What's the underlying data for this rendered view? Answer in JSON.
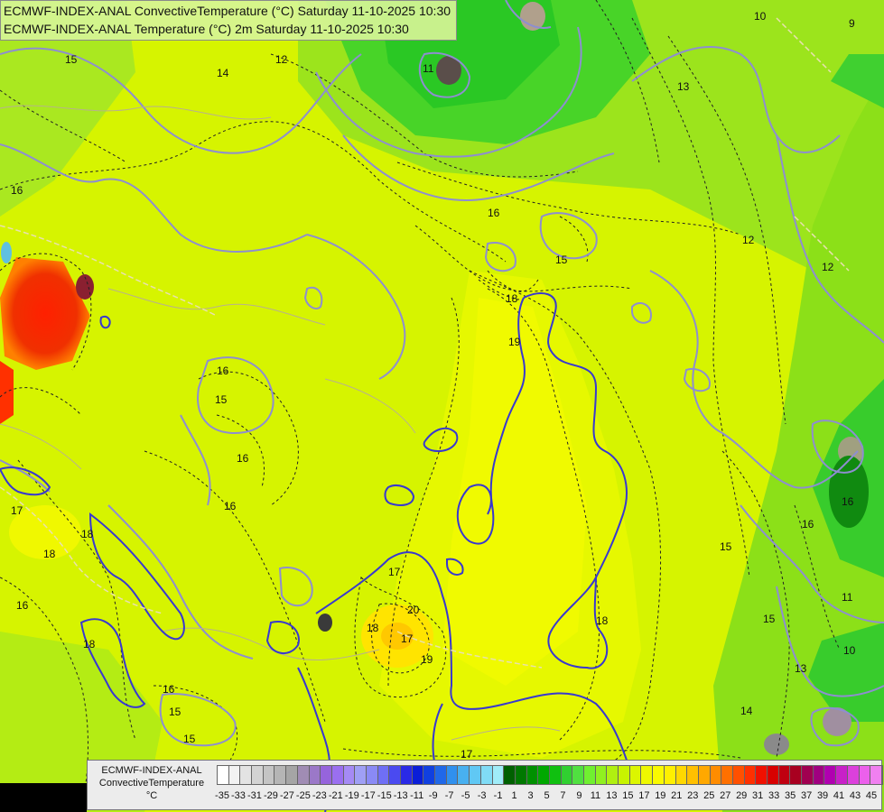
{
  "header": {
    "line1": "ECMWF-INDEX-ANAL ConvectiveTemperature (°C) Saturday 11-10-2025 10:30",
    "line2": "ECMWF-INDEX-ANAL Temperature (°C) 2m Saturday 11-10-2025 10:30"
  },
  "legend": {
    "line1": "ECMWF-INDEX-ANAL",
    "line2": "ConvectiveTemperature",
    "unit": "°C",
    "tick_labels": [
      "-35",
      "-33",
      "-31",
      "-29",
      "-27",
      "-25",
      "-23",
      "-21",
      "-19",
      "-17",
      "-15",
      "-13",
      "-11",
      "-9",
      "-7",
      "-5",
      "-3",
      "-1",
      "1",
      "3",
      "5",
      "7",
      "9",
      "11",
      "13",
      "15",
      "17",
      "19",
      "21",
      "23",
      "25",
      "27",
      "29",
      "31",
      "33",
      "35",
      "37",
      "39",
      "41",
      "43",
      "45"
    ],
    "colors": [
      "#ffffff",
      "#f2f2f2",
      "#e3e3e3",
      "#d3d3d3",
      "#c4c4c4",
      "#b5b5b5",
      "#a5a5a5",
      "#a08cb4",
      "#9b78c8",
      "#9664dc",
      "#9a6ff0",
      "#a58af5",
      "#9f9ff5",
      "#8a8af5",
      "#6f6ff5",
      "#4a4af0",
      "#2a2ae6",
      "#0a1ed8",
      "#1040e0",
      "#2068e8",
      "#3090ee",
      "#48b0f0",
      "#60c8f4",
      "#80dcf6",
      "#a0ecf8",
      "#006000",
      "#007800",
      "#009000",
      "#00a800",
      "#10c010",
      "#30d030",
      "#50e040",
      "#70f030",
      "#90f020",
      "#b0f010",
      "#c8f400",
      "#dcf600",
      "#eef800",
      "#fafa00",
      "#fff000",
      "#ffd800",
      "#ffc000",
      "#ffa800",
      "#ff8c00",
      "#ff7000",
      "#ff5000",
      "#ff3000",
      "#f01000",
      "#d80000",
      "#c00010",
      "#a80020",
      "#a00050",
      "#a00080",
      "#b000b0",
      "#c820c8",
      "#dc40dc",
      "#ec60ec",
      "#f080f0"
    ]
  },
  "contour_labels": [
    {
      "text": "15"
    },
    {
      "text": "12"
    },
    {
      "text": "14"
    },
    {
      "text": "11"
    },
    {
      "text": "10"
    },
    {
      "text": "9"
    },
    {
      "text": "13"
    },
    {
      "text": "16"
    },
    {
      "text": "16"
    },
    {
      "text": "15"
    },
    {
      "text": "18"
    },
    {
      "text": "19"
    },
    {
      "text": "12"
    },
    {
      "text": "12"
    },
    {
      "text": "16"
    },
    {
      "text": "15"
    },
    {
      "text": "16"
    },
    {
      "text": "17"
    },
    {
      "text": "16"
    },
    {
      "text": "18"
    },
    {
      "text": "18"
    },
    {
      "text": "16"
    },
    {
      "text": "17"
    },
    {
      "text": "18"
    },
    {
      "text": "20"
    },
    {
      "text": "17"
    },
    {
      "text": "19"
    },
    {
      "text": "18"
    },
    {
      "text": "15"
    },
    {
      "text": "16"
    },
    {
      "text": "18"
    },
    {
      "text": "16"
    },
    {
      "text": "15"
    },
    {
      "text": "17"
    },
    {
      "text": "15"
    },
    {
      "text": "11"
    },
    {
      "text": "13"
    },
    {
      "text": "14"
    },
    {
      "text": "10"
    },
    {
      "text": "15"
    },
    {
      "text": "16"
    }
  ]
}
